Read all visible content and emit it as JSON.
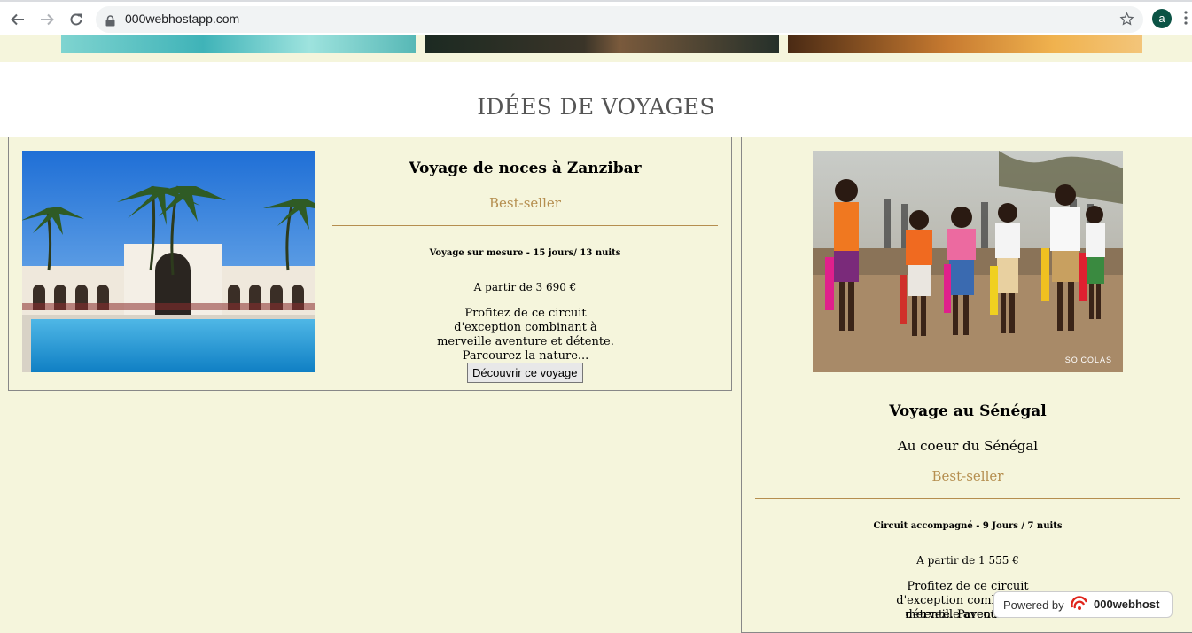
{
  "browser": {
    "url": "000webhostapp.com",
    "profile_initial": "a"
  },
  "page": {
    "section_heading": "IDÉES DE VOYAGES",
    "trips": [
      {
        "title": "Voyage de noces à Zanzibar",
        "tag": "Best-seller",
        "meta": "Voyage sur mesure - 15 jours/ 13 nuits",
        "price": "A partir de 3 690 €",
        "description": "Profitez de ce circuit d'exception combinant à merveille aventure et détente. Parcourez la nature...",
        "button": "Découvrir ce voyage"
      },
      {
        "title": "Voyage au Sénégal",
        "subtitle": "Au coeur du Sénégal",
        "tag": "Best-seller",
        "meta": "Circuit accompagné - 9 Jours / 7 nuits",
        "price": "A partir de 1 555 €",
        "description": "Profitez de ce circuit d'exception combinant à merveille aventure et",
        "description_cut": "détente. Parcourez la",
        "photo_credit": "SO'COLAS"
      }
    ],
    "powered_by": {
      "label": "Powered by",
      "brand": "000webhost"
    }
  },
  "colors": {
    "page_bg": "#f5f5dc",
    "accent": "#b58e4f"
  }
}
